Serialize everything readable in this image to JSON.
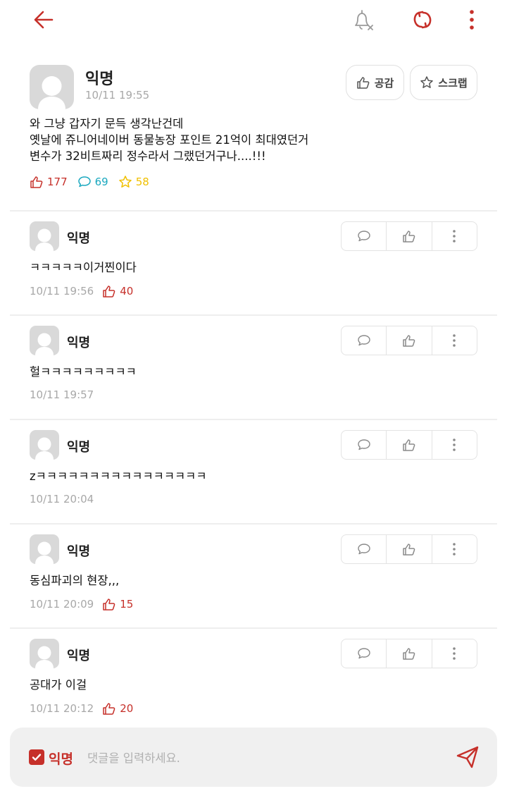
{
  "colors": {
    "accent": "#c6302a",
    "comment_stat": "#1aa8bf",
    "scrap_stat": "#f0c000",
    "muted": "#a8a8a8"
  },
  "topbar": {
    "back_icon": "arrow-left-icon",
    "bell_icon": "bell-off-icon",
    "refresh_icon": "refresh-icon",
    "more_icon": "more-vertical-icon"
  },
  "post": {
    "author": "익명",
    "time": "10/11 19:55",
    "like_button": "공감",
    "scrap_button": "스크랩",
    "body": "와 그냥 갑자기 문득 생각난건데\n옛날에 쥬니어네이버 동물농장 포인트 21억이 최대였던거\n변수가 32비트짜리 정수라서 그랬던거구나....!!!",
    "likes": "177",
    "comments": "69",
    "scraps": "58"
  },
  "comments": [
    {
      "author": "익명",
      "text": "ㅋㅋㅋㅋㅋ이거찐이다",
      "time": "10/11 19:56",
      "likes": "40"
    },
    {
      "author": "익명",
      "text": "헐ㅋㅋㅋㅋㅋㅋㅋㅋㅋ",
      "time": "10/11 19:57",
      "likes": null
    },
    {
      "author": "익명",
      "text": "zㅋㅋㅋㅋㅋㅋㅋㅋㅋㅋㅋㅋㅋㅋㅋㅋ",
      "time": "10/11 20:04",
      "likes": null
    },
    {
      "author": "익명",
      "text": "동심파괴의 현장,,,",
      "time": "10/11 20:09",
      "likes": "15"
    },
    {
      "author": "익명",
      "text": "공대가 이걸",
      "time": "10/11 20:12",
      "likes": "20"
    }
  ],
  "input": {
    "anon_label": "익명",
    "anon_checked": true,
    "placeholder": "댓글을 입력하세요."
  }
}
